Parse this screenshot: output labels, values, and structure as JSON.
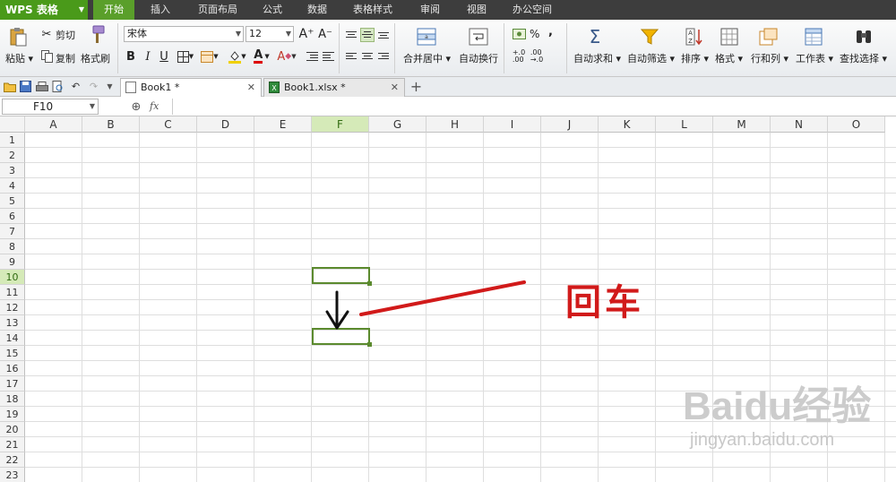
{
  "app": {
    "name": "WPS 表格"
  },
  "menu_tabs": [
    "开始",
    "插入",
    "页面布局",
    "公式",
    "数据",
    "表格样式",
    "审阅",
    "视图",
    "办公空间"
  ],
  "ribbon": {
    "clipboard": {
      "paste": "粘贴",
      "cut": "剪切",
      "copy": "复制",
      "format_painter": "格式刷"
    },
    "font": {
      "name": "宋体",
      "size": "12"
    },
    "merge_center": "合并居中",
    "wrap_text": "自动换行",
    "number": {
      "percent": "%",
      "comma": ","
    },
    "autosum": "自动求和",
    "autofilter": "自动筛选",
    "sort": "排序",
    "format": "格式",
    "rows_cols": "行和列",
    "worksheet": "工作表",
    "find_select": "查找选择"
  },
  "doc_tabs": [
    {
      "label": "Book1 *"
    },
    {
      "label": "Book1.xlsx *"
    }
  ],
  "formula_bar": {
    "name_box": "F10",
    "fx": "fx",
    "value": ""
  },
  "columns": [
    "A",
    "B",
    "C",
    "D",
    "E",
    "F",
    "G",
    "H",
    "I",
    "J",
    "K",
    "L",
    "M",
    "N",
    "O"
  ],
  "selected_column": "F",
  "rows": [
    "1",
    "2",
    "3",
    "4",
    "5",
    "6",
    "7",
    "8",
    "9",
    "10",
    "11",
    "12",
    "13",
    "14",
    "15",
    "16",
    "17",
    "18",
    "19",
    "20",
    "21",
    "22",
    "23"
  ],
  "selected_row": "10",
  "annotation": {
    "text": "回车"
  },
  "watermark": {
    "brand": "Baidu经验",
    "url": "jingyan.baidu.com"
  },
  "colors": {
    "accent": "#5a9f2a",
    "annotation_red": "#d11a1a",
    "selection_border": "#5b8a2e"
  }
}
